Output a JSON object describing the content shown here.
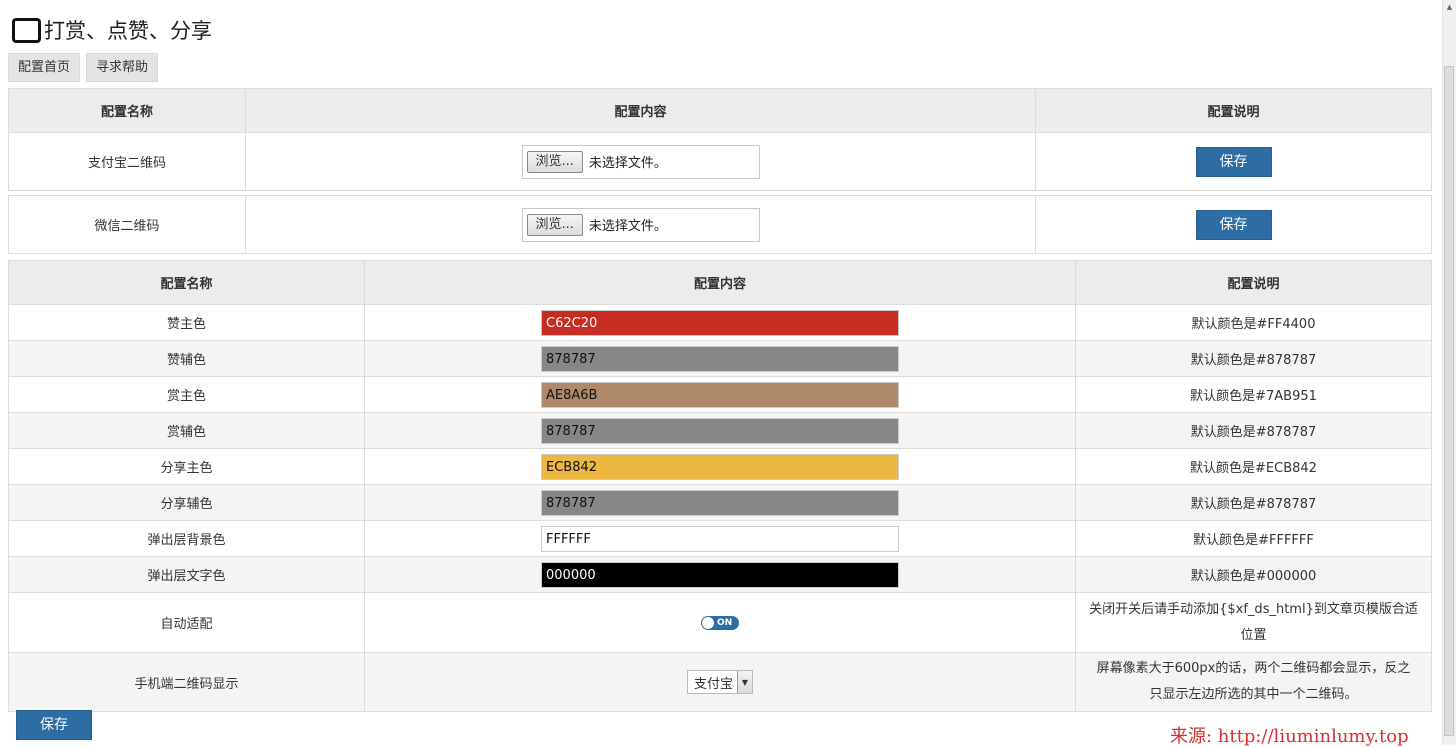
{
  "page_title": "打赏、点赞、分享",
  "tabs": [
    {
      "label": "配置首页"
    },
    {
      "label": "寻求帮助"
    }
  ],
  "upload_table": {
    "headers": [
      "配置名称",
      "配置内容",
      "配置说明"
    ],
    "browse_label": "浏览...",
    "no_file_label": "未选择文件。",
    "save_label": "保存",
    "rows": [
      {
        "name": "支付宝二维码"
      },
      {
        "name": "微信二维码"
      }
    ]
  },
  "settings_table": {
    "headers": [
      "配置名称",
      "配置内容",
      "配置说明"
    ],
    "colors": [
      {
        "name": "赞主色",
        "value": "C62C20",
        "bg": "#C62C20",
        "fg": "#ffffff",
        "note": "默认颜色是#FF4400"
      },
      {
        "name": "赞辅色",
        "value": "878787",
        "bg": "#878787",
        "fg": "#111111",
        "note": "默认颜色是#878787"
      },
      {
        "name": "赏主色",
        "value": "AE8A6B",
        "bg": "#AE8A6B",
        "fg": "#111111",
        "note": "默认颜色是#7AB951"
      },
      {
        "name": "赏辅色",
        "value": "878787",
        "bg": "#878787",
        "fg": "#111111",
        "note": "默认颜色是#878787"
      },
      {
        "name": "分享主色",
        "value": "ECB842",
        "bg": "#ECB842",
        "fg": "#111111",
        "note": "默认颜色是#ECB842"
      },
      {
        "name": "分享辅色",
        "value": "878787",
        "bg": "#878787",
        "fg": "#111111",
        "note": "默认颜色是#878787"
      },
      {
        "name": "弹出层背景色",
        "value": "FFFFFF",
        "bg": "#FFFFFF",
        "fg": "#111111",
        "note": "默认颜色是#FFFFFF"
      },
      {
        "name": "弹出层文字色",
        "value": "000000",
        "bg": "#000000",
        "fg": "#ffffff",
        "note": "默认颜色是#000000"
      }
    ],
    "auto_fit": {
      "name": "自动适配",
      "toggle_label": "ON",
      "note_line1": "关闭开关后请手动添加{$xf_ds_html}到文章页模版合适",
      "note_line2": "位置"
    },
    "mobile_qr": {
      "name": "手机端二维码显示",
      "selected": "支付宝",
      "note_line1": "屏幕像素大于600px的话，两个二维码都会显示，反之",
      "note_line2": "只显示左边所选的其中一个二维码。"
    }
  },
  "save_button_label": "保存",
  "source_text": "来源: http://liuminlumy.top"
}
